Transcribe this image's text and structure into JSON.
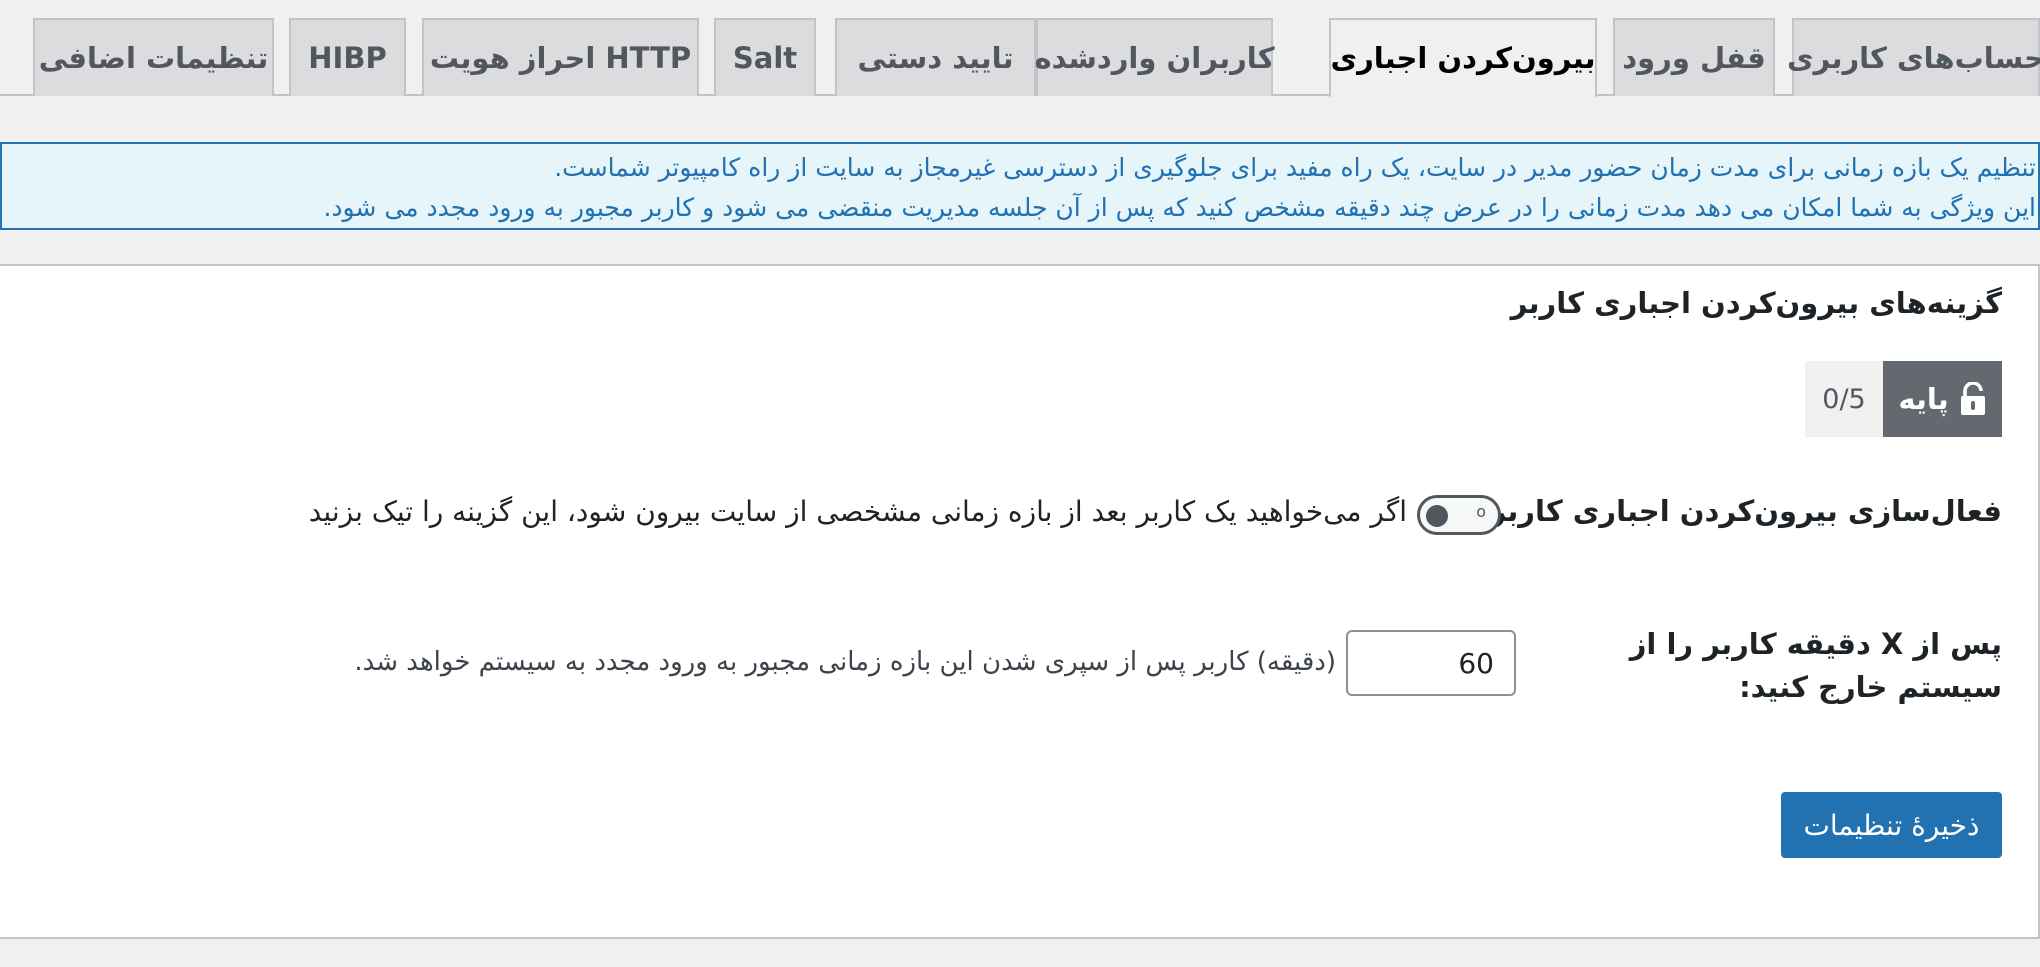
{
  "tabs": [
    {
      "label": "حساب‌های کاربری",
      "active": false
    },
    {
      "label": "قفل ورود",
      "active": false
    },
    {
      "label": "بیرون‌کردن اجباری",
      "active": true
    },
    {
      "label": "کاربران واردشده",
      "active": false
    },
    {
      "label": "تایید دستی",
      "active": false
    },
    {
      "label": "Salt",
      "active": false
    },
    {
      "label": "احراز هویت HTTP",
      "active": false
    },
    {
      "label": "HIBP",
      "active": false
    },
    {
      "label": "تنظیمات اضافی",
      "active": false
    }
  ],
  "notice": {
    "line1": "تنظیم یک بازه زمانی برای مدت زمان حضور مدیر در سایت، یک راه مفید برای جلوگیری از دسترسی غیرمجاز به سایت از راه کامپیوتر شماست.",
    "line2": "این ویژگی به شما امکان می دهد مدت زمانی را در عرض چند دقیقه مشخص کنید که پس از آن جلسه مدیریت منقضی می شود و کاربر مجبور به ورود مجدد می شود."
  },
  "box": {
    "title": "گزینه‌های بیرون‌کردن اجباری کاربر",
    "badge_level": "پایه",
    "badge_score": "0/5",
    "badge_icon": "unlock-icon"
  },
  "enable_row": {
    "label": "فعال‌سازی بیرون‌کردن اجباری کاربر:",
    "toggle_state": "o",
    "toggle_on": false,
    "description": "اگر می‌خواهید یک کاربر بعد از بازه زمانی مشخصی از سایت بیرون شود، این گزینه را تیک بزنید"
  },
  "minutes_row": {
    "label": "پس از X دقیقه کاربر را از سیستم خارج کنید:",
    "value": "60",
    "description": "(دقیقه) کاربر پس از سپری شدن این بازه زمانی مجبور به ورود مجدد به سیستم خواهد شد."
  },
  "save_label": "ذخیرهٔ تنظیمات",
  "colors": {
    "primary": "#2271b1",
    "notice_bg": "#e5f5fa",
    "badge_dark": "#646970"
  }
}
